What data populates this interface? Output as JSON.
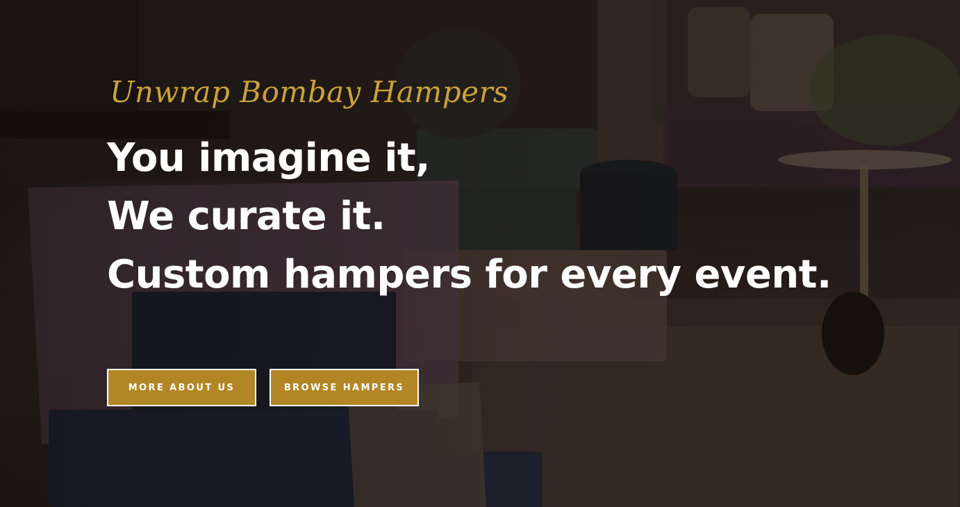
{
  "hero": {
    "brand_script": "Unwrap Bombay Hampers",
    "headline_lines": [
      "You imagine it,",
      "We curate it.",
      "Custom hampers for every event."
    ],
    "buttons": {
      "about_label": "MORE ABOUT US",
      "browse_label": "BROWSE HAMPERS"
    }
  },
  "colors": {
    "accent_gold": "#b38625",
    "script_gold": "#c9a23a",
    "headline": "#ffffff"
  }
}
